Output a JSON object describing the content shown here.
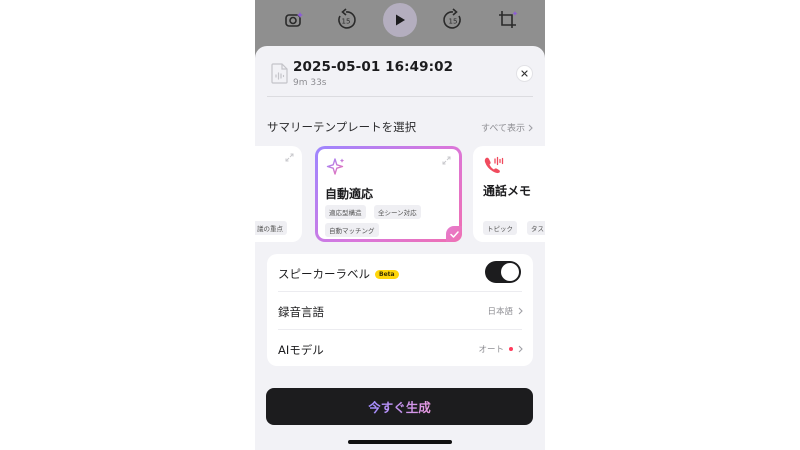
{
  "toolbar": {
    "icons": [
      "ai-camera-icon",
      "rewind-15-icon",
      "play-icon",
      "forward-15-icon",
      "crop-sparkle-icon"
    ],
    "rewind_label": "15",
    "forward_label": "15"
  },
  "recording": {
    "title": "2025-05-01 16:49:02",
    "duration": "9m 33s"
  },
  "templates": {
    "section_title": "サマリーテンプレートを選択",
    "see_all": "すべて表示",
    "cards": [
      {
        "title": "",
        "tags": [
          "議の重点"
        ],
        "selected": false
      },
      {
        "title": "自動適応",
        "tags": [
          "適応型構造",
          "全シーン対応",
          "自動マッチング"
        ],
        "selected": true
      },
      {
        "title": "通話メモ",
        "tags": [
          "トピック",
          "タス"
        ],
        "selected": false
      }
    ]
  },
  "settings": {
    "speaker_label": {
      "label": "スピーカーラベル",
      "badge": "Beta",
      "enabled": true
    },
    "language": {
      "label": "録音言語",
      "value": "日本語"
    },
    "ai_model": {
      "label": "AIモデル",
      "value": "オート"
    }
  },
  "generate_button": {
    "label": "今すぐ生成"
  },
  "colors": {
    "accent_gradient_start": "#9d86ff",
    "accent_gradient_end": "#f06fb0",
    "beta_badge": "#ffd60a",
    "model_dot": "#ff3b5c",
    "sheet_bg": "#f2f2f6"
  }
}
